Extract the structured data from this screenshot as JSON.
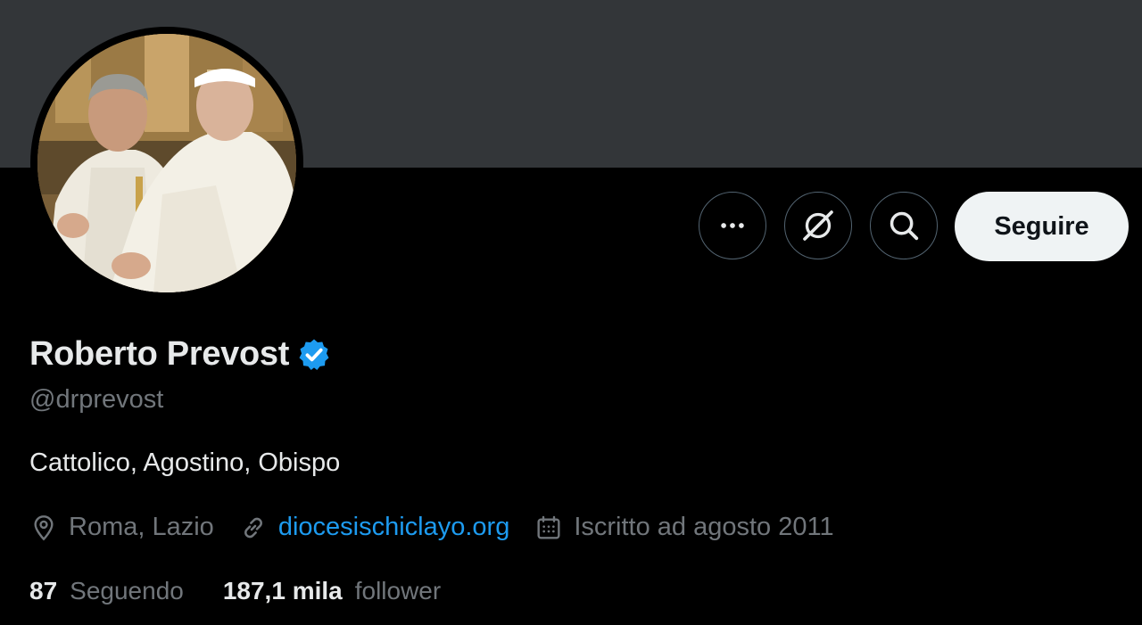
{
  "profile": {
    "display_name": "Roberto Prevost",
    "handle": "@drprevost",
    "bio": "Cattolico, Agostino, Obispo",
    "location": "Roma, Lazio",
    "website": "diocesischiclayo.org",
    "joined": "Iscritto ad agosto 2011"
  },
  "actions": {
    "more_icon": "more-horizontal-icon",
    "grok_icon": "grok-icon",
    "search_icon": "search-icon",
    "follow_label": "Seguire"
  },
  "stats": {
    "following_count": "87",
    "following_label": "Seguendo",
    "followers_count": "187,1 mila",
    "followers_label": "follower"
  },
  "colors": {
    "background": "#000000",
    "banner": "#333639",
    "accent": "#1d9bf0",
    "secondary_text": "#71767b",
    "primary_text": "#e7e9ea"
  }
}
